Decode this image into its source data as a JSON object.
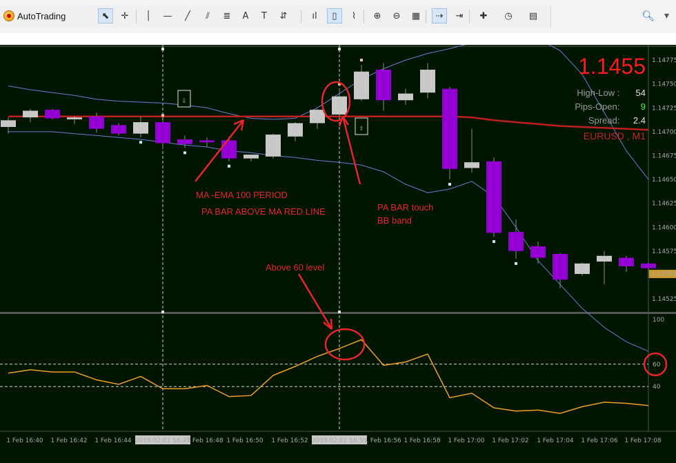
{
  "toolbar": {
    "autotrading_label": "AutoTrading",
    "tools": [
      "cursor",
      "crosshair",
      "vertical-line",
      "horizontal-line",
      "trendline",
      "equidistant-channel",
      "fibonacci",
      "text",
      "text-label",
      "arrows",
      "bar-chart",
      "candlestick",
      "line-chart",
      "zoom-in",
      "zoom-out",
      "tile-windows",
      "autoscroll",
      "chart-shift",
      "indicators",
      "periods",
      "templates"
    ],
    "icon_glyphs": {
      "cursor": "⬉",
      "crosshair": "✛",
      "vertical-line": "│",
      "horizontal-line": "—",
      "trendline": "╱",
      "equidistant-channel": "⫽",
      "fibonacci": "≣",
      "text": "A",
      "text-label": "T",
      "arrows": "⇵",
      "bar-chart": "ıl",
      "candlestick": "▯",
      "line-chart": "⌇",
      "zoom-in": "⊕",
      "zoom-out": "⊖",
      "tile-windows": "▦",
      "autoscroll": "⇢",
      "chart-shift": "⇥",
      "indicators": "✚",
      "periods": "◷",
      "templates": "▤"
    }
  },
  "info": {
    "price": "1.1455",
    "high_low_label": "High-Low :",
    "high_low_value": "54",
    "pips_open_label": "Pips-Open:",
    "pips_open_value": "9",
    "spread_label": "Spread:",
    "spread_value": "2.4",
    "symbol": "EURUSD , M1"
  },
  "colors": {
    "background": "#011600",
    "bull_candle": "#c8c8c8",
    "bear_candle": "#9400d3",
    "ma_line": "#c0201e",
    "bb_line": "#6a7bdc",
    "oscillator": "#f0a020",
    "annotation": "#e8262a",
    "price_text": "#ff1a1a",
    "pips_open_value": "#3cff3c"
  },
  "price_axis": {
    "labels": [
      "1.14775",
      "1.14750",
      "1.14725",
      "1.14700",
      "1.14675",
      "1.14650",
      "1.14625",
      "1.14600",
      "1.14575",
      "1.14550",
      "1.14525"
    ],
    "current": "1.14551"
  },
  "oscillator_axis": {
    "labels": [
      "100",
      "60",
      "40"
    ],
    "levels": [
      60,
      40
    ]
  },
  "time_axis": {
    "labels": [
      "1 Feb 16:40",
      "1 Feb 16:42",
      "1 Feb 16:44",
      "2019.02.01 16:47",
      "1 Feb 16:48",
      "1 Feb 16:50",
      "1 Feb 16:52",
      "2019.02.01 16:55",
      "1 Feb 16:56",
      "1 Feb 16:58",
      "1 Feb 17:00",
      "1 Feb 17:02",
      "1 Feb 17:04",
      "1 Feb 17:06",
      "1 Feb 17:08"
    ]
  },
  "annotations": {
    "ma_line1": "MA -EMA 100 PERIOD",
    "ma_line2": "PA BAR ABOVE MA RED LINE",
    "bb_line1": "PA BAR touch",
    "bb_line2": "BB band",
    "level": "Above 60 level"
  },
  "chart_data": {
    "type": "candlestick",
    "candles": [
      {
        "o": 1.14705,
        "h": 1.14715,
        "l": 1.14698,
        "c": 1.14712
      },
      {
        "o": 1.14715,
        "h": 1.14724,
        "l": 1.1471,
        "c": 1.14722
      },
      {
        "o": 1.14723,
        "h": 1.14724,
        "l": 1.14713,
        "c": 1.14714
      },
      {
        "o": 1.14713,
        "h": 1.14716,
        "l": 1.14708,
        "c": 1.14715
      },
      {
        "o": 1.14716,
        "h": 1.1472,
        "l": 1.14699,
        "c": 1.14703
      },
      {
        "o": 1.14707,
        "h": 1.14709,
        "l": 1.14696,
        "c": 1.14698
      },
      {
        "o": 1.14698,
        "h": 1.14716,
        "l": 1.14694,
        "c": 1.1471
      },
      {
        "o": 1.1471,
        "h": 1.14712,
        "l": 1.14682,
        "c": 1.14688
      },
      {
        "o": 1.14692,
        "h": 1.14696,
        "l": 1.14683,
        "c": 1.14687
      },
      {
        "o": 1.14691,
        "h": 1.14694,
        "l": 1.14684,
        "c": 1.14689
      },
      {
        "o": 1.14691,
        "h": 1.14695,
        "l": 1.14669,
        "c": 1.14672
      },
      {
        "o": 1.14672,
        "h": 1.14676,
        "l": 1.14669,
        "c": 1.14676
      },
      {
        "o": 1.14674,
        "h": 1.14698,
        "l": 1.14672,
        "c": 1.14697
      },
      {
        "o": 1.14695,
        "h": 1.1471,
        "l": 1.1469,
        "c": 1.14709
      },
      {
        "o": 1.14709,
        "h": 1.14724,
        "l": 1.14703,
        "c": 1.14723
      },
      {
        "o": 1.14718,
        "h": 1.14745,
        "l": 1.14716,
        "c": 1.14737
      },
      {
        "o": 1.14734,
        "h": 1.1477,
        "l": 1.14732,
        "c": 1.14763
      },
      {
        "o": 1.14765,
        "h": 1.14772,
        "l": 1.14722,
        "c": 1.14733
      },
      {
        "o": 1.14733,
        "h": 1.14745,
        "l": 1.14728,
        "c": 1.1474
      },
      {
        "o": 1.14741,
        "h": 1.14772,
        "l": 1.14735,
        "c": 1.14765
      },
      {
        "o": 1.14745,
        "h": 1.14747,
        "l": 1.1465,
        "c": 1.14661
      },
      {
        "o": 1.14662,
        "h": 1.14703,
        "l": 1.14657,
        "c": 1.14668
      },
      {
        "o": 1.14669,
        "h": 1.14673,
        "l": 1.1459,
        "c": 1.14594
      },
      {
        "o": 1.14595,
        "h": 1.14608,
        "l": 1.14567,
        "c": 1.14575
      },
      {
        "o": 1.1458,
        "h": 1.14585,
        "l": 1.14562,
        "c": 1.14568
      },
      {
        "o": 1.14572,
        "h": 1.14573,
        "l": 1.14536,
        "c": 1.14545
      },
      {
        "o": 1.14551,
        "h": 1.14563,
        "l": 1.14549,
        "c": 1.14562
      },
      {
        "o": 1.14564,
        "h": 1.14575,
        "l": 1.1454,
        "c": 1.1457
      },
      {
        "o": 1.14568,
        "h": 1.1457,
        "l": 1.14553,
        "c": 1.14559
      },
      {
        "o": 1.14562,
        "h": 1.14563,
        "l": 1.14547,
        "c": 1.14557
      }
    ],
    "ma": [
      1.14716,
      1.14716,
      1.14716,
      1.14716,
      1.14716,
      1.14716,
      1.14716,
      1.14716,
      1.14716,
      1.14716,
      1.14716,
      1.14716,
      1.14716,
      1.14716,
      1.14716,
      1.14716,
      1.14716,
      1.14716,
      1.14716,
      1.14716,
      1.14716,
      1.14715,
      1.14712,
      1.1471,
      1.14708,
      1.14706,
      1.14705,
      1.14704,
      1.14703,
      1.14702
    ],
    "bb_upper": [
      1.14748,
      1.14744,
      1.14741,
      1.14738,
      1.14734,
      1.14732,
      1.14731,
      1.1473,
      1.14728,
      1.14725,
      1.14719,
      1.14714,
      1.14713,
      1.14714,
      1.14725,
      1.1474,
      1.14755,
      1.14766,
      1.14775,
      1.14782,
      1.14787,
      1.14793,
      1.148,
      1.14805,
      1.14797,
      1.14785,
      1.1476,
      1.1472,
      1.1468,
      1.1465
    ],
    "bb_lower": [
      1.147,
      1.147,
      1.147,
      1.14698,
      1.14696,
      1.14694,
      1.14692,
      1.14689,
      1.14686,
      1.14684,
      1.1468,
      1.14678,
      1.14675,
      1.14673,
      1.1467,
      1.14668,
      1.14665,
      1.14658,
      1.14645,
      1.14636,
      1.1464,
      1.14648,
      1.14632,
      1.146,
      1.14565,
      1.1454,
      1.14515,
      1.14495,
      1.1448,
      1.1447
    ],
    "fractals_up": [
      7,
      15,
      16
    ],
    "fractals_down": [
      6,
      8,
      10,
      20,
      22,
      23
    ],
    "oscillator": [
      52,
      55,
      53,
      53,
      46,
      42,
      49,
      38,
      38,
      41,
      31,
      32,
      50,
      58,
      67,
      74,
      82,
      59,
      62,
      69,
      30,
      34,
      21,
      18,
      19,
      16,
      22,
      26,
      25,
      23
    ],
    "oscillator_ylim": [
      0,
      100
    ],
    "price_ylim": [
      1.14512,
      1.14791
    ]
  }
}
